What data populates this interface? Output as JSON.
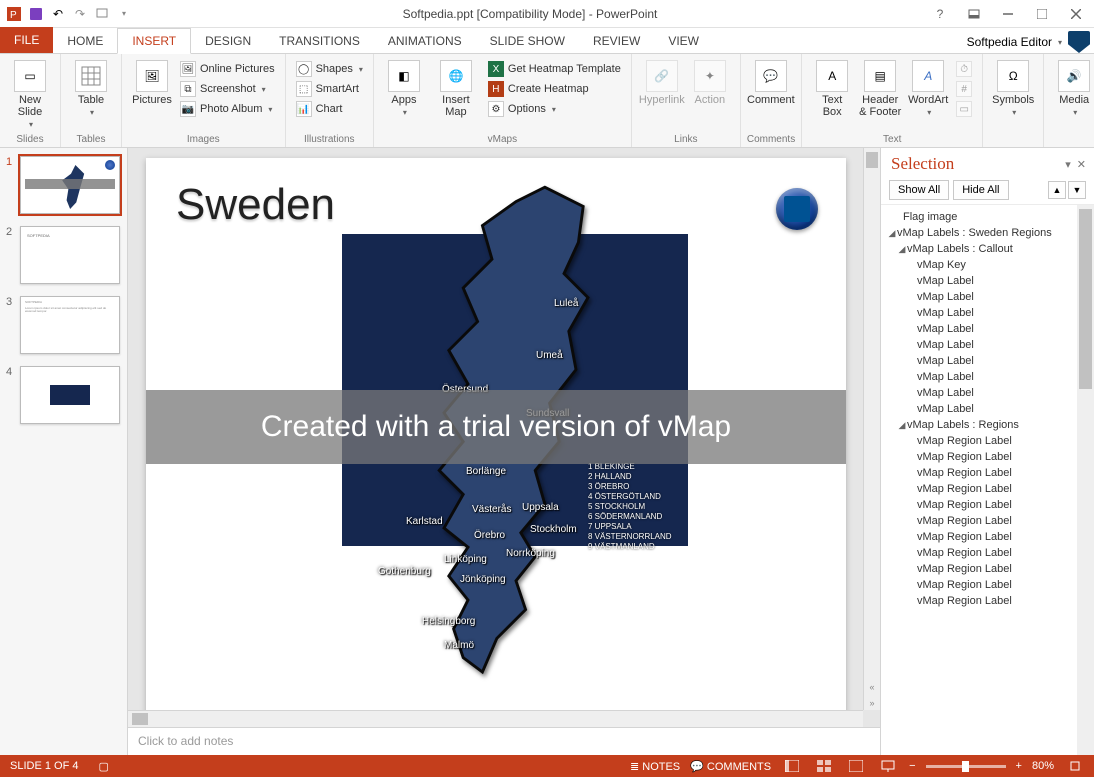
{
  "window": {
    "title": "Softpedia.ppt [Compatibility Mode] - PowerPoint",
    "help_icon": "?",
    "user_label": "Softpedia Editor"
  },
  "tabs": {
    "file": "FILE",
    "home": "HOME",
    "insert": "INSERT",
    "design": "DESIGN",
    "transitions": "TRANSITIONS",
    "animations": "ANIMATIONS",
    "slideshow": "SLIDE SHOW",
    "review": "REVIEW",
    "view": "VIEW"
  },
  "ribbon": {
    "new_slide": "New\nSlide",
    "slides_group": "Slides",
    "table": "Table",
    "tables_group": "Tables",
    "pictures": "Pictures",
    "online_pictures": "Online Pictures",
    "screenshot": "Screenshot",
    "photo_album": "Photo Album",
    "images_group": "Images",
    "shapes": "Shapes",
    "smartart": "SmartArt",
    "chart": "Chart",
    "illustrations_group": "Illustrations",
    "apps": "Apps",
    "insert_map": "Insert\nMap",
    "get_heatmap": "Get Heatmap Template",
    "create_heatmap": "Create Heatmap",
    "options": "Options",
    "vmaps_group": "vMaps",
    "hyperlink": "Hyperlink",
    "action": "Action",
    "links_group": "Links",
    "comment": "Comment",
    "comments_group": "Comments",
    "text_box": "Text\nBox",
    "header_footer": "Header\n& Footer",
    "wordart": "WordArt",
    "text_group": "Text",
    "symbols": "Symbols",
    "media": "Media"
  },
  "thumbnails": {
    "n1": "1",
    "n2": "2",
    "n3": "3",
    "n4": "4"
  },
  "slide": {
    "title": "Sweden",
    "watermark": "Created with a trial version of vMap",
    "cities": {
      "lulea": "Luleå",
      "umea": "Umeå",
      "ostersund": "Östersund",
      "sundsvall": "Sundsvall",
      "borlange": "Borlänge",
      "vasteras": "Västerås",
      "uppsala": "Uppsala",
      "karlstad": "Karlstad",
      "stockholm": "Stockholm",
      "orebro": "Örebro",
      "norrkoping": "Norrköping",
      "linkoping": "Linköping",
      "jonkoping": "Jönköping",
      "gothenburg": "Gothenburg",
      "helsingborg": "Helsingborg",
      "malmo": "Malmö"
    },
    "legend": {
      "l1": "1 BLEKINGE",
      "l2": "2 HALLAND",
      "l3": "3 ÖREBRO",
      "l4": "4 ÖSTERGÖTLAND",
      "l5": "5 STOCKHOLM",
      "l6": "6 SÖDERMANLAND",
      "l7": "7 UPPSALA",
      "l8": "8 VÄSTERNORRLAND",
      "l9": "9 VÄSTMANLAND"
    }
  },
  "notes": {
    "placeholder": "Click to add notes"
  },
  "selection": {
    "title": "Selection",
    "show_all": "Show All",
    "hide_all": "Hide All",
    "items": {
      "flag": "Flag image",
      "sweden": "vMap Labels : Sweden Regions",
      "callout": "vMap Labels : Callout",
      "vmap_key": "vMap Key",
      "vmap_label": "vMap Label",
      "regions": "vMap Labels : Regions",
      "region_label": "vMap Region Label"
    }
  },
  "status": {
    "slide_of": "SLIDE 1 OF 4",
    "notes": "NOTES",
    "comments": "COMMENTS",
    "zoom": "80%"
  }
}
